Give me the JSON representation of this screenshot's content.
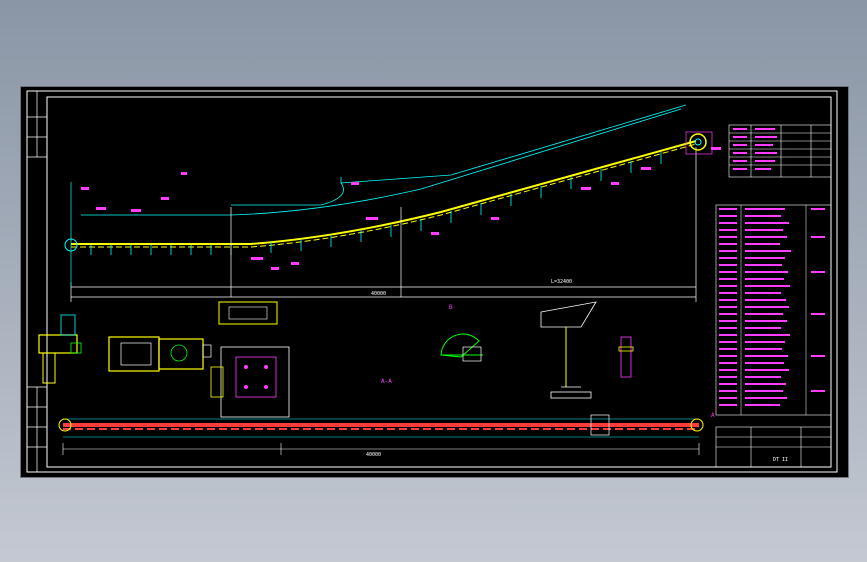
{
  "window": {
    "title": ""
  },
  "colors": {
    "background": "#000000",
    "frame": "#ffffff",
    "belt": "#ffff00",
    "dimension": "#00ffff",
    "text": "#ff3cff",
    "chain": "#ff3c3c",
    "green": "#00ff00"
  },
  "drawing": {
    "labels": {
      "main_span": "40000",
      "conveyor_length": "L=32400",
      "head_station": "A",
      "section_a": "A-A",
      "section_b": "B",
      "bottom_total": "40000",
      "title_block_name": "DT II"
    },
    "icons": [
      "drive-unit-icon",
      "pulley-icon",
      "idler-icon",
      "gear-wheel-icon"
    ]
  }
}
